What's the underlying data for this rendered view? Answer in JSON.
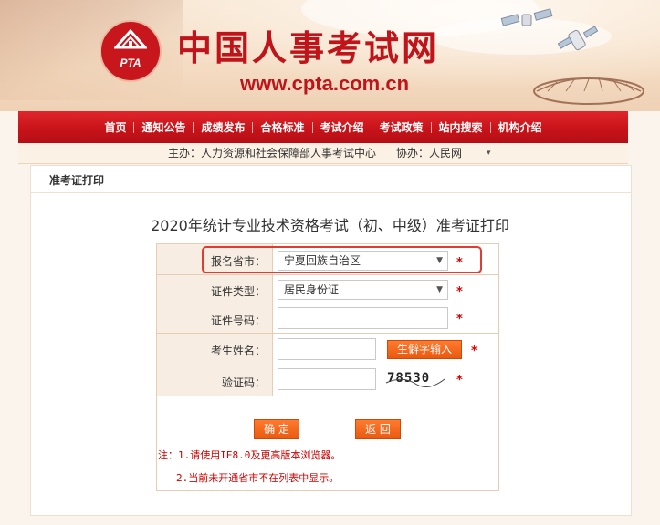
{
  "header": {
    "logo_text": "PTA",
    "site_name": "中国人事考试网",
    "site_url": "www.cpta.com.cn"
  },
  "nav": {
    "items": [
      "首页",
      "通知公告",
      "成绩发布",
      "合格标准",
      "考试介绍",
      "考试政策",
      "站内搜索",
      "机构介绍"
    ]
  },
  "subbar": {
    "host": "主办：人力资源和社会保障部人事考试中心",
    "co": "协办：人民网"
  },
  "main": {
    "breadcrumb": "准考证打印",
    "form_title": "2020年统计专业技术资格考试（初、中级）准考证打印"
  },
  "form": {
    "province_label": "报名省市：",
    "province_value": "宁夏回族自治区",
    "idtype_label": "证件类型：",
    "idtype_value": "居民身份证",
    "idnum_label": "证件号码：",
    "idnum_value": "",
    "name_label": "考生姓名：",
    "name_value": "",
    "rare_char_button": "生僻字输入",
    "captcha_label": "验证码：",
    "captcha_value": "",
    "captcha_image_text": "78530",
    "required_mark": "*",
    "confirm_button": "确 定",
    "back_button": "返 回",
    "note1": "注：1.请使用IE8.0及更高版本浏览器。",
    "note2": "2.当前未开通省市不在列表中显示。"
  },
  "colors": {
    "brand_red": "#c0141a",
    "button_orange": "#f06a1c",
    "highlight": "#e23b32"
  }
}
